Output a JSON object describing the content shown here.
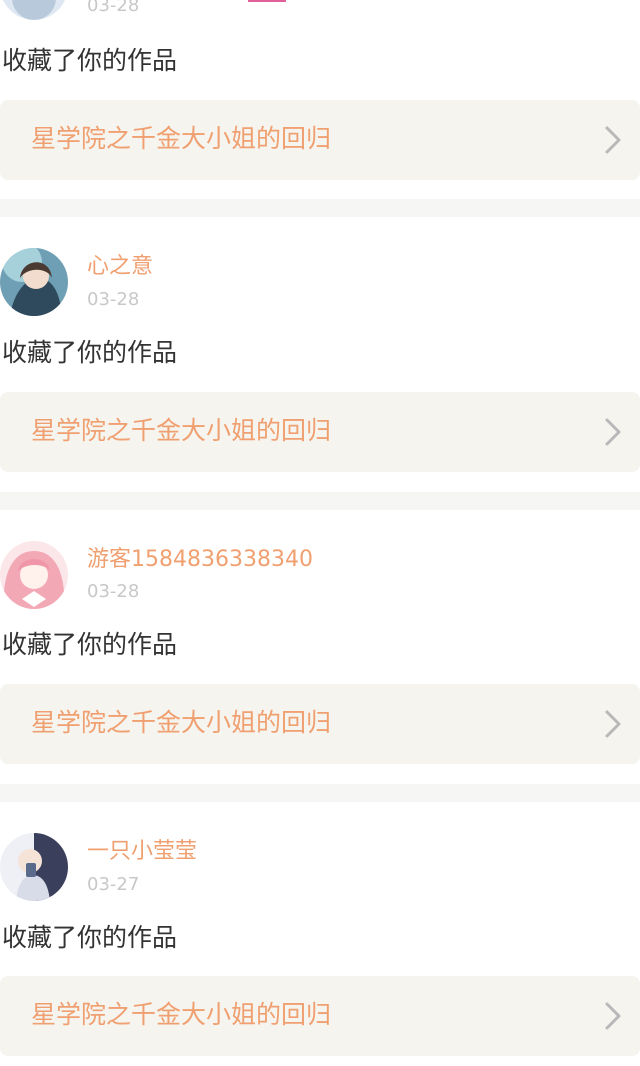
{
  "colors": {
    "accent_text": "#f0a070",
    "action_text": "#333333",
    "date_text": "#c8c8c8",
    "card_bg": "#f5f4ef",
    "separator": "#f6f6f4"
  },
  "feed": [
    {
      "name": "",
      "date": "03-28",
      "action": "收藏了你的作品",
      "work_title": "星学院之千金大小姐的回归",
      "avatar_icon": "user-avatar-icon"
    },
    {
      "name": "心之意",
      "date": "03-28",
      "action": "收藏了你的作品",
      "work_title": "星学院之千金大小姐的回归",
      "avatar_icon": "user-avatar-icon"
    },
    {
      "name": "游客1584836338340",
      "date": "03-28",
      "action": "收藏了你的作品",
      "work_title": "星学院之千金大小姐的回归",
      "avatar_icon": "user-avatar-icon"
    },
    {
      "name": "一只小莹莹",
      "date": "03-27",
      "action": "收藏了你的作品",
      "work_title": "星学院之千金大小姐的回归",
      "avatar_icon": "user-avatar-icon"
    }
  ]
}
